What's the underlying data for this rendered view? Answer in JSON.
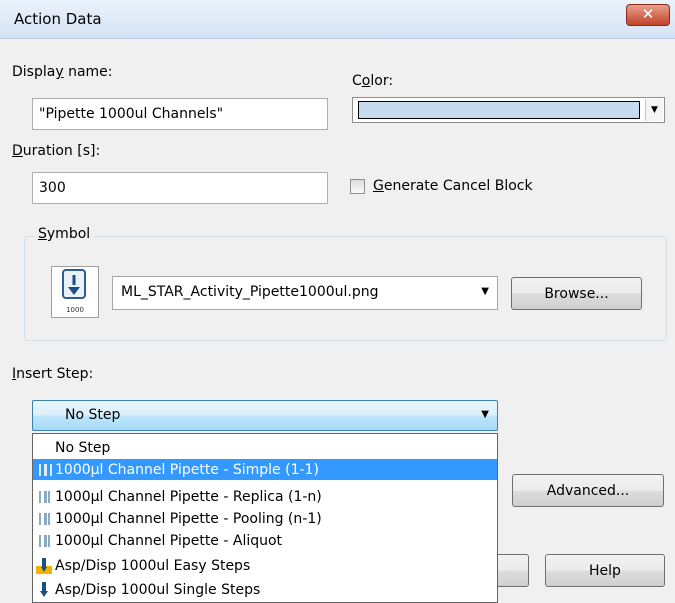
{
  "window": {
    "title": "Action Data",
    "close_symbol": "✕"
  },
  "display_name": {
    "label": "Display name:",
    "access_key": "y",
    "value": "\"Pipette 1000ul Channels\""
  },
  "color": {
    "label": "Color:",
    "access_key": "o",
    "value_hex": "#c6daf0"
  },
  "duration": {
    "label": "Duration [s]:",
    "access_key": "D",
    "value": "300"
  },
  "generate_cancel_block": {
    "label": "Generate Cancel Block",
    "access_key": "G",
    "checked": false
  },
  "symbol": {
    "group_label": "Symbol",
    "icon_caption": "1000",
    "icon": "pipette-1000-icon",
    "file": "ML_STAR_Activity_Pipette1000ul.png",
    "browse_label": "Browse..."
  },
  "insert_step": {
    "label": "Insert Step:",
    "access_key": "I",
    "selected": "No Step",
    "options": [
      {
        "label": "No Step",
        "icon": ""
      },
      {
        "label": "1000µl Channel Pipette - Simple (1-1)",
        "icon": "channel-pipette-icon",
        "highlighted": true
      },
      {
        "label": "1000µl Channel Pipette - Replica (1-n)",
        "icon": "channel-pipette-icon"
      },
      {
        "label": "1000µl Channel Pipette - Pooling (n-1)",
        "icon": "channel-pipette-icon"
      },
      {
        "label": "1000µl Channel Pipette - Aliquot",
        "icon": "channel-pipette-icon"
      },
      {
        "label": "Asp/Disp 1000ul Easy Steps",
        "icon": "easy-step-icon"
      },
      {
        "label": "Asp/Disp 1000ul Single Steps",
        "icon": "single-step-icon"
      }
    ]
  },
  "buttons": {
    "advanced": "Advanced...",
    "help": "Help"
  },
  "colors": {
    "highlight": "#3399ff",
    "dialog_bg": "#f0f0f0",
    "close_red": "#c2432b"
  }
}
